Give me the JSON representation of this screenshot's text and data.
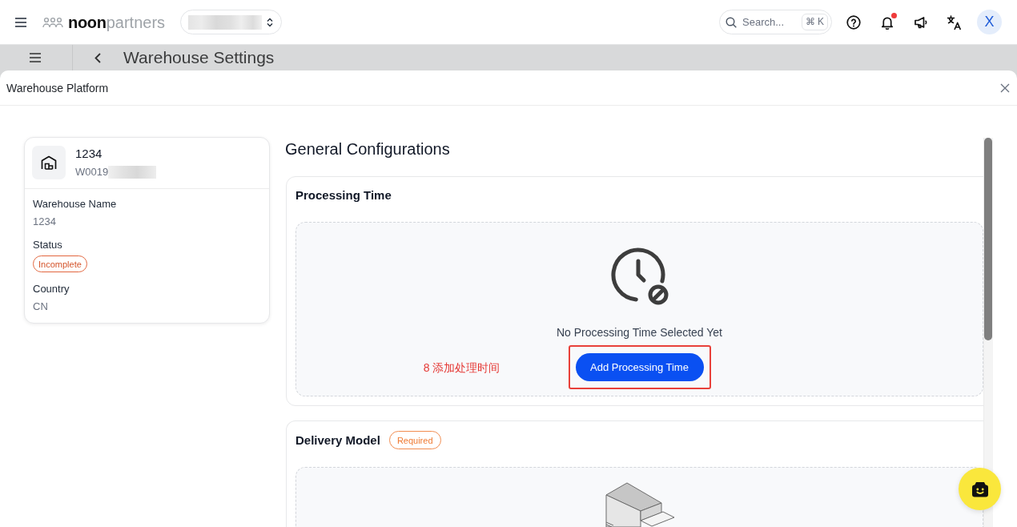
{
  "header": {
    "logo": "**noon**partners",
    "search": {
      "placeholder": "Search...",
      "shortcut": "⌘ K"
    },
    "notifications": {
      "unread": true
    },
    "avatar": {
      "initial": "X"
    }
  },
  "background_page": {
    "title": "Warehouse Settings"
  },
  "modal": {
    "title": "Warehouse Platform"
  },
  "warehouse_card": {
    "name": "1234",
    "code": "W0019",
    "fields": [
      {
        "label": "Warehouse Name",
        "value": "1234",
        "kind": "text"
      },
      {
        "label": "Status",
        "value": "Incomplete",
        "kind": "badge"
      },
      {
        "label": "Country",
        "value": "CN",
        "kind": "text"
      }
    ]
  },
  "configurations": {
    "title": "General Configurations",
    "sections": [
      {
        "title": "Processing Time",
        "kind": "empty_state",
        "empty_message": "No Processing Time Selected Yet",
        "action": "Add Processing Time",
        "annotation": "8 添加处理时间"
      },
      {
        "title": "Delivery Model",
        "badge": "Required",
        "kind": "illustration"
      }
    ]
  }
}
